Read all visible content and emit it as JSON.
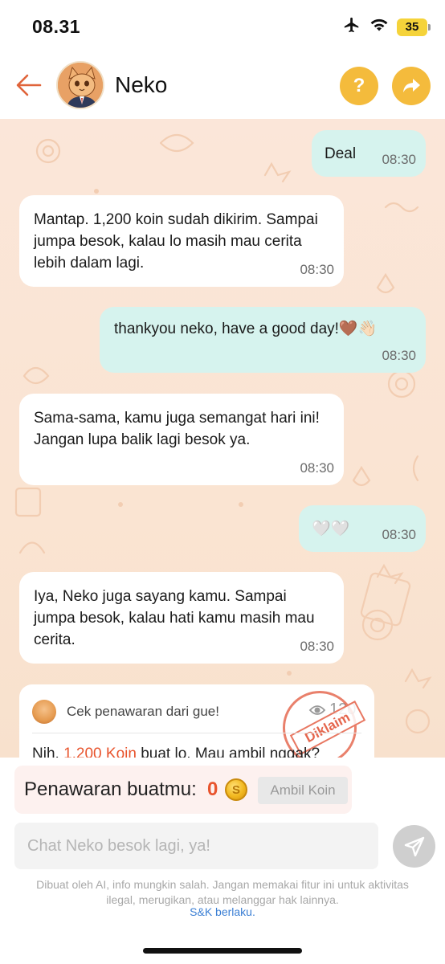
{
  "status_bar": {
    "time": "08.31",
    "battery": "35"
  },
  "header": {
    "contact_name": "Neko",
    "help_label": "?"
  },
  "messages": [
    {
      "direction": "out",
      "text": "Deal",
      "time": "08:30"
    },
    {
      "direction": "in",
      "text": "Mantap. 1,200 koin sudah dikirim. Sampai jumpa besok, kalau lo masih mau cerita lebih dalam lagi.",
      "time": "08:30"
    },
    {
      "direction": "out",
      "text": "thankyou neko, have a good day!🤎👋🏻",
      "time": "08:30"
    },
    {
      "direction": "in",
      "text": "Sama-sama, kamu juga semangat hari ini! Jangan lupa balik lagi besok ya.",
      "time": "08:30"
    },
    {
      "direction": "out",
      "text": "🤍🤍",
      "time": "08:30"
    },
    {
      "direction": "in",
      "text": "Iya, Neko juga sayang kamu. Sampai jumpa besok, kalau hati kamu masih mau cerita.",
      "time": "08:30"
    }
  ],
  "offer_card": {
    "title": "Cek penawaran dari gue!",
    "count": "120",
    "stamp": "Diklaim",
    "line_prefix": "Nih, ",
    "line_amount": "1,200 Koin",
    "line_suffix": " buat lo. Mau ambil nggak?"
  },
  "offer_bar": {
    "label": "Penawaran buatmu:",
    "value": "0",
    "claim_label": "Ambil Koin"
  },
  "input": {
    "placeholder": "Chat Neko besok lagi, ya!"
  },
  "disclaimer": "Dibuat oleh AI, info mungkin salah. Jangan memakai fitur ini untuk aktivitas ilegal, merugikan, atau melanggar hak lainnya.",
  "tos_link": "S&K berlaku.",
  "colors": {
    "accent": "#f4bb3c",
    "back_arrow": "#e0643a",
    "outgoing_bubble": "#d6f3ee",
    "incoming_bubble": "#ffffff",
    "chat_background": "#fae4d2",
    "offer_value": "#e8542d",
    "link": "#3b7fd4"
  },
  "icons": {
    "back": "arrow-left-icon",
    "help": "question-icon",
    "share": "share-arrow-icon",
    "wifi": "wifi-icon",
    "airplane": "airplane-icon",
    "send": "send-icon",
    "coin": "coin-icon"
  }
}
